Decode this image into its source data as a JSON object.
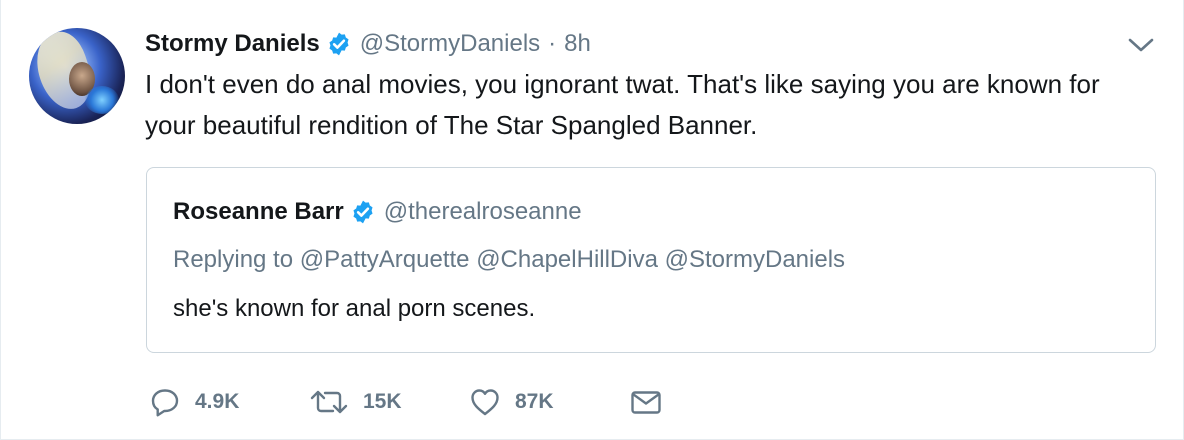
{
  "tweet": {
    "author": {
      "name": "Stormy Daniels",
      "handle": "@StormyDaniels",
      "verified": true
    },
    "separator": "·",
    "time": "8h",
    "text": "I don't even do anal movies, you ignorant twat. That's like saying you are known for your beautiful rendition of The Star Spangled Banner."
  },
  "quote": {
    "author": {
      "name": "Roseanne Barr",
      "handle": "@therealroseanne",
      "verified": true
    },
    "replying_to": "Replying to @PattyArquette @ChapelHillDiva @StormyDaniels",
    "text": "she's known for anal porn scenes."
  },
  "actions": {
    "reply_count": "4.9K",
    "retweet_count": "15K",
    "like_count": "87K"
  },
  "icons": {
    "verified": "verified-badge-icon",
    "menu": "chevron-down-icon",
    "reply": "reply-icon",
    "retweet": "retweet-icon",
    "like": "heart-icon",
    "dm": "envelope-icon"
  },
  "colors": {
    "verified_blue": "#1da1f2",
    "text_primary": "#14171a",
    "text_secondary": "#657786",
    "border": "#ccd6dd"
  }
}
